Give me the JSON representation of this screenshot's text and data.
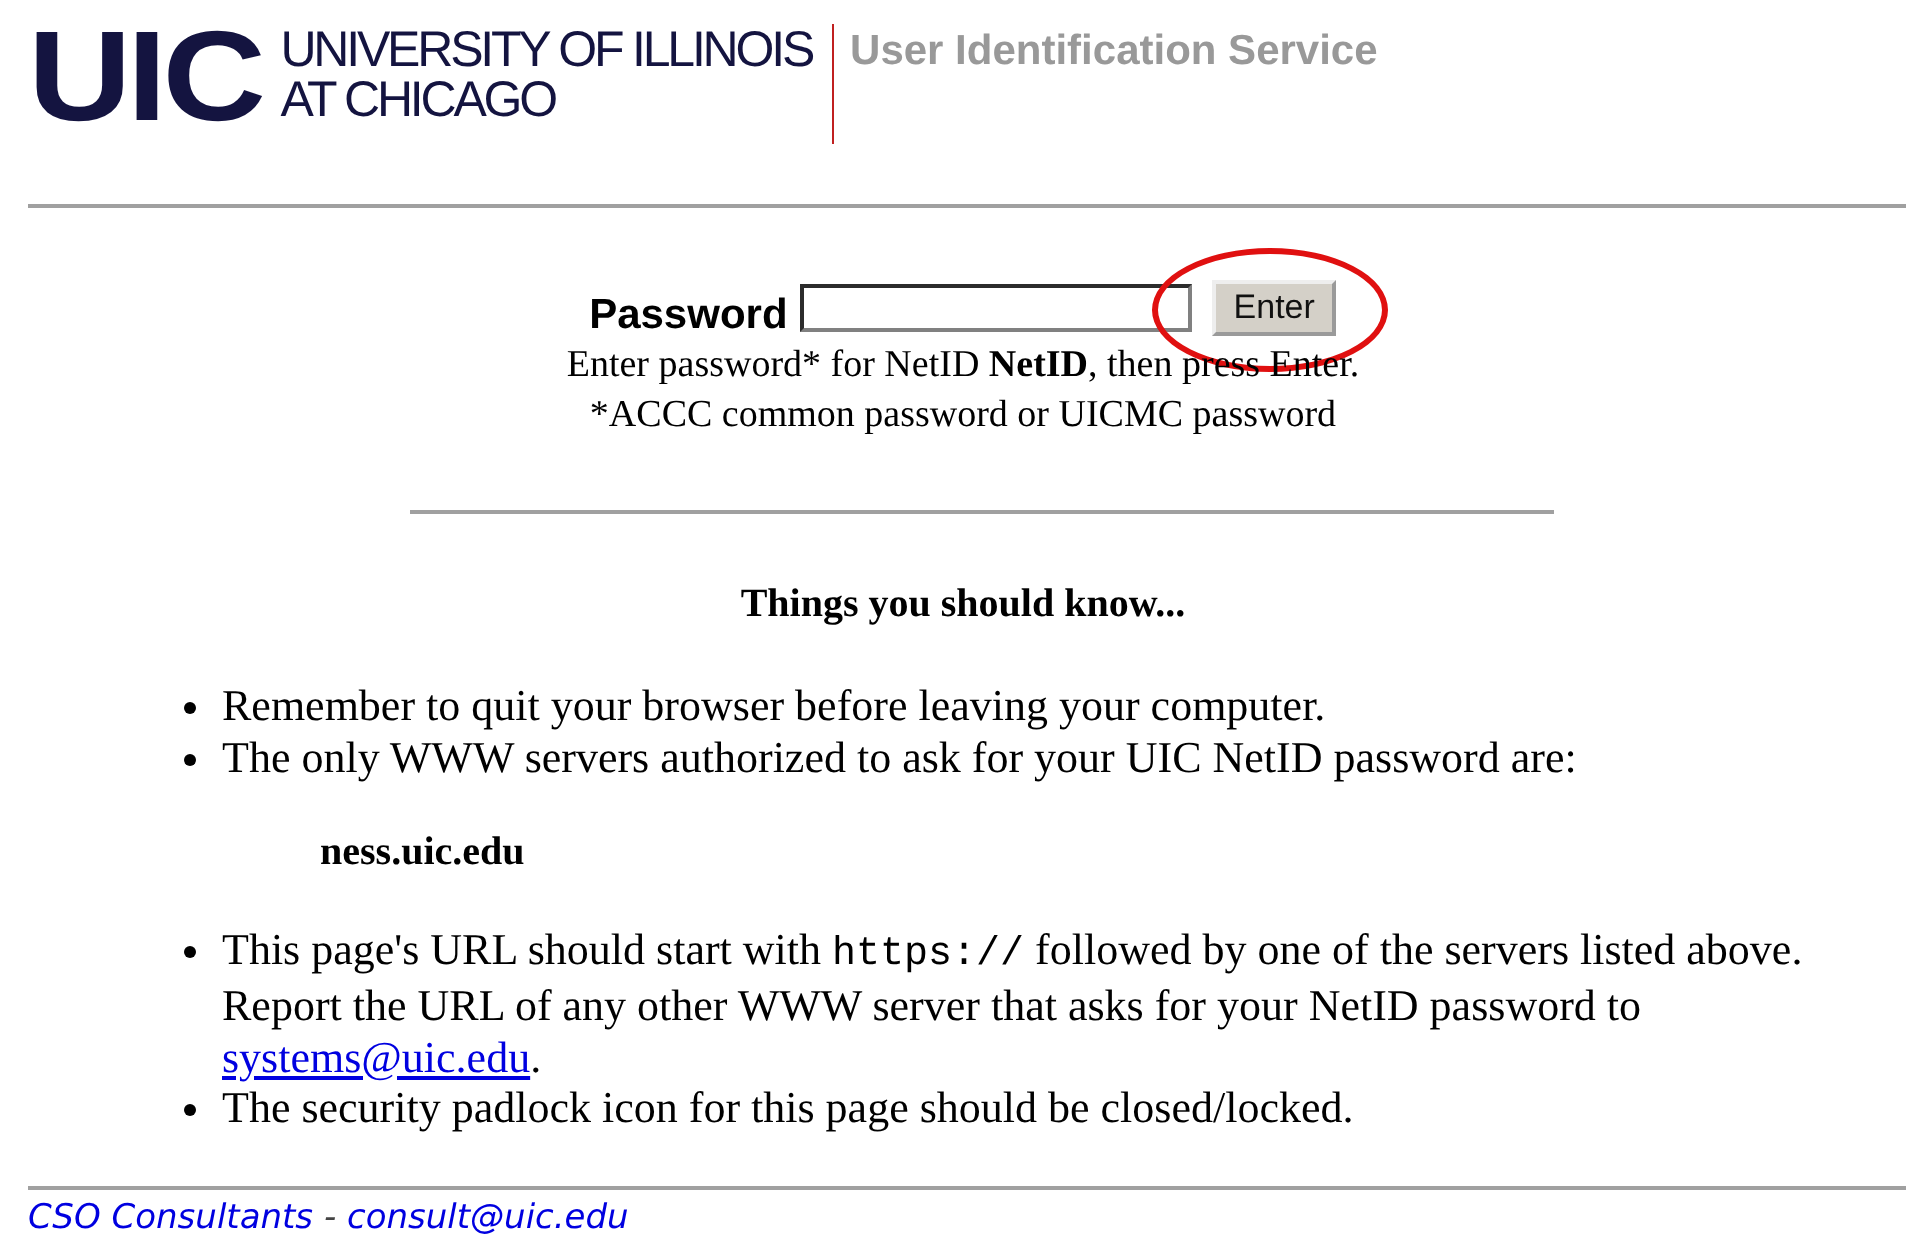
{
  "header": {
    "logo_mark": "UIC",
    "logo_lines": [
      "UNIVERSITY OF ILLINOIS",
      "AT CHICAGO"
    ],
    "service_title": "User Identification Service"
  },
  "login": {
    "label": "Password",
    "button": "Enter",
    "button_circled": true,
    "hint": "Enter password* for NetID **NetID**, then press Enter.",
    "footnote": "*ACCC common password or UICMC password"
  },
  "info": {
    "heading": "Things you should know...",
    "items": [
      {
        "parts": [
          {
            "kind": "text",
            "text": "Remember to quit your browser before leaving your computer."
          }
        ]
      },
      {
        "parts": [
          {
            "kind": "text",
            "text": "The only WWW servers authorized to ask for your UIC NetID password are:"
          }
        ],
        "servers": [
          "ness.uic.edu"
        ]
      },
      {
        "parts": [
          {
            "kind": "text",
            "text": "This page's URL should start with "
          },
          {
            "kind": "code",
            "text": "https://"
          },
          {
            "kind": "text",
            "text": " followed by one of the servers listed above. Report the URL of any other WWW server that asks for your NetID password to "
          },
          {
            "kind": "link",
            "text": "systems@uic.edu"
          },
          {
            "kind": "text",
            "text": "."
          }
        ]
      },
      {
        "parts": [
          {
            "kind": "text",
            "text": "The security padlock icon for this page should be closed/locked."
          }
        ]
      }
    ]
  },
  "footer": {
    "parts": [
      {
        "kind": "link",
        "text": "CSO Consultants"
      },
      {
        "kind": "text",
        "text": " - "
      },
      {
        "kind": "link",
        "text": "consult@uic.edu"
      }
    ]
  }
}
